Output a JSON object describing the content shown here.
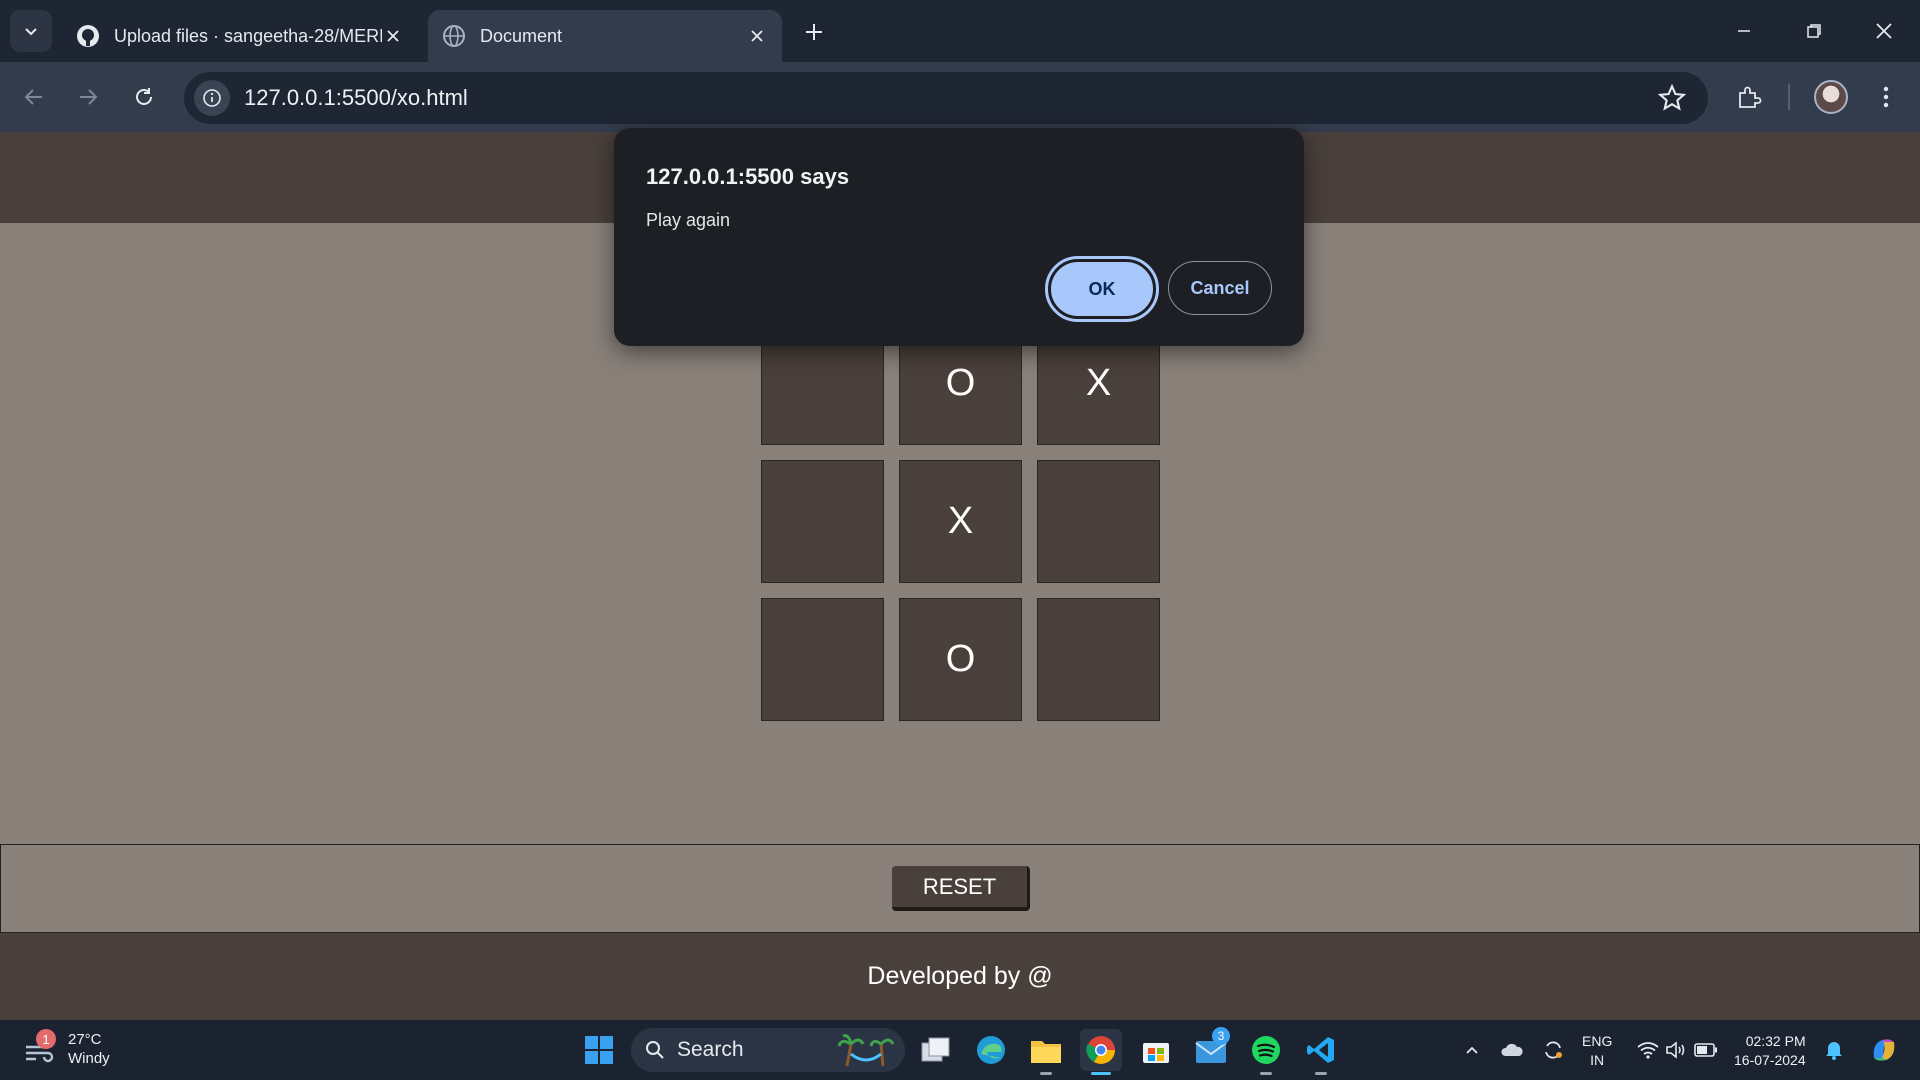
{
  "browser": {
    "tabs": [
      {
        "title": "Upload files · sangeetha-28/MERN",
        "favicon": "github-icon",
        "active": false
      },
      {
        "title": "Document",
        "favicon": "globe-icon",
        "active": true
      }
    ],
    "url": "127.0.0.1:5500/xo.html"
  },
  "dialog": {
    "title": "127.0.0.1:5500 says",
    "message": "Play again",
    "ok_label": "OK",
    "cancel_label": "Cancel"
  },
  "game": {
    "board": [
      "",
      "O",
      "X",
      "",
      "X",
      "",
      "",
      "O",
      ""
    ],
    "reset_label": "RESET",
    "footer_text": "Developed by @"
  },
  "taskbar": {
    "weather": {
      "temp": "27°C",
      "condition": "Windy",
      "badge": "1"
    },
    "search_label": "Search",
    "mail_badge": "3",
    "lang_line1": "ENG",
    "lang_line2": "IN",
    "time": "02:32 PM",
    "date": "16-07-2024"
  },
  "colors": {
    "page_bg": "#8a807a",
    "cell_bg": "#4a403b",
    "dialog_bg": "#1d1f24",
    "ok_button": "#a8c7fa"
  }
}
